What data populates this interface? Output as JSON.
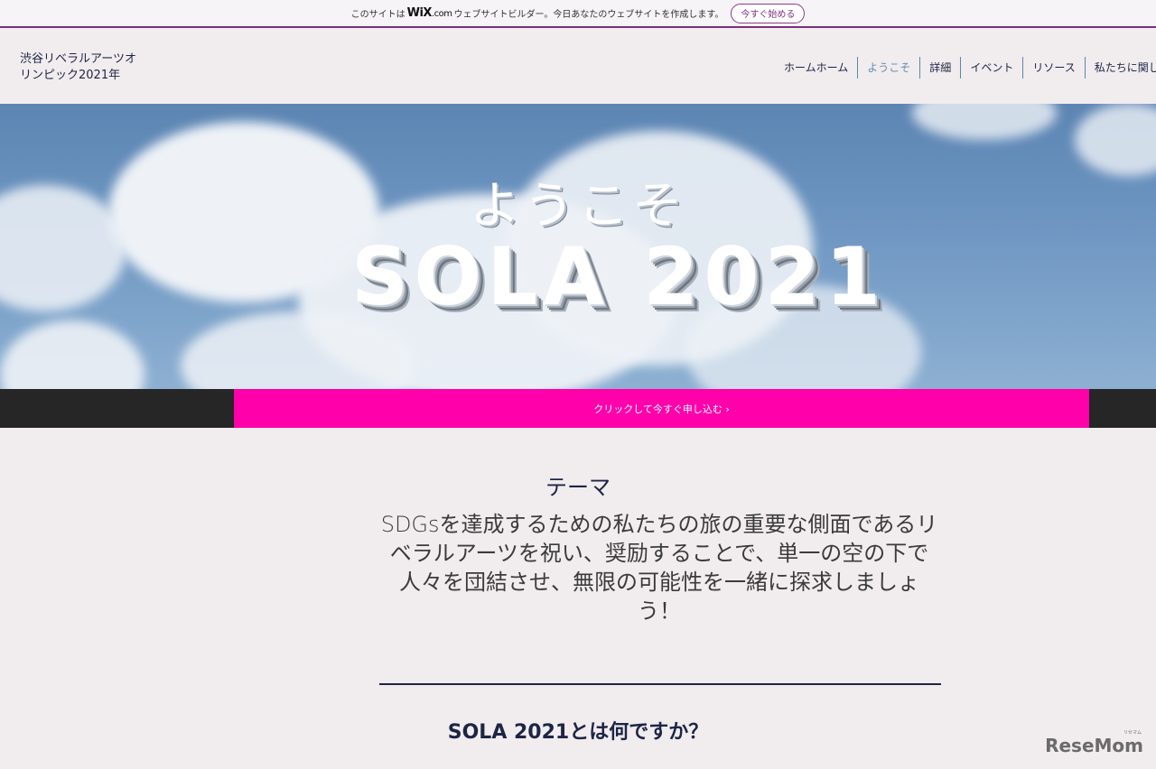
{
  "wix_banner": {
    "text_prefix": "このサイトは",
    "logo": "WiX",
    "logo_suffix": ".com",
    "text_suffix": "ウェブサイトビルダー。今日あなたのウェブサイトを作成します。",
    "cta_label": "今すぐ始める"
  },
  "header": {
    "site_title": "渋谷リベラルアーツオリンピック2021年",
    "nav": [
      {
        "label": "ホームホーム",
        "active": false
      },
      {
        "label": "ようこそ",
        "active": true
      },
      {
        "label": "詳細",
        "active": false
      },
      {
        "label": "イベント",
        "active": false
      },
      {
        "label": "リソース",
        "active": false
      },
      {
        "label": "私たちに関して",
        "active": false
      }
    ]
  },
  "hero": {
    "welcome": "ようこそ",
    "title": "SOLA 2021"
  },
  "cta": {
    "label": "クリックして今すぐ申し込む ›"
  },
  "theme": {
    "heading": "テーマ",
    "body": "SDGsを達成するための私たちの旅の重要な側面であるリベラルアーツを祝い、奨励することで、単一の空の下で人々を団結させ、無限の可能性を一緒に探求しましょう！"
  },
  "about": {
    "heading": "SOLA 2021とは何ですか？"
  },
  "watermark": {
    "text": "ReseMom",
    "sub": "リセマム"
  },
  "colors": {
    "accent": "#ff00aa",
    "wix_purple": "#7c2f7d",
    "navy": "#1d2545",
    "strip": "#262627",
    "background": "#f1ecee"
  }
}
